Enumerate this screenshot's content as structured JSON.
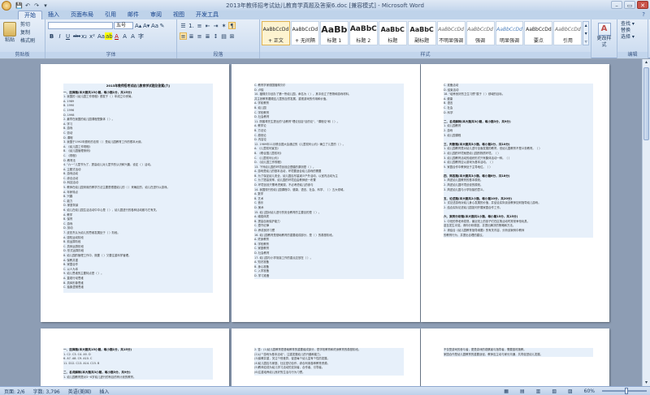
{
  "window": {
    "title": "2013年教师招考试幼儿教育学真题及答案6.doc [兼容模式] - Microsoft Word",
    "min": "–",
    "max": "▭",
    "close": "✕"
  },
  "qat": [
    "💾",
    "↶",
    "↷",
    "▾"
  ],
  "tabs": [
    "开始",
    "插入",
    "页面布局",
    "引用",
    "邮件",
    "审阅",
    "视图",
    "开发工具"
  ],
  "active_tab": "开始",
  "help_icon": "?",
  "clipboard": {
    "paste": "粘贴",
    "cut": "剪切",
    "copy": "复制",
    "format_painter": "格式刷",
    "label": "剪贴板"
  },
  "font": {
    "family": "",
    "size": "五号",
    "label": "字体",
    "buttons_row1": [
      "A▴",
      "A▾",
      "Aa",
      "✎",
      "变",
      "A"
    ],
    "buttons_row2": [
      "B",
      "I",
      "U",
      "abc",
      "x₂",
      "x²",
      "Aa",
      "ab",
      "A",
      "A",
      "A",
      "字"
    ]
  },
  "paragraph": {
    "label": "段落",
    "row1": [
      "☰",
      "1.",
      "≡",
      "⇤",
      "⇥",
      "✶",
      "¶"
    ],
    "row2": [
      "≡",
      "≣",
      "≡",
      "≣",
      "↕",
      "▤",
      "⊞"
    ]
  },
  "styles": {
    "label": "样式",
    "items": [
      {
        "sample": "AaBbCcDd",
        "name": "+ 正文",
        "cls": "",
        "selected": true
      },
      {
        "sample": "AaBbCcDd",
        "name": "+ 无间隔",
        "cls": ""
      },
      {
        "sample": "AaBb",
        "name": "标题 1",
        "cls": "h1"
      },
      {
        "sample": "AaBbC",
        "name": "标题 2",
        "cls": "h2"
      },
      {
        "sample": "AaBbC",
        "name": "标题",
        "cls": "h3"
      },
      {
        "sample": "AaBbC",
        "name": "副标题",
        "cls": "h3"
      },
      {
        "sample": "AaBbCcDd",
        "name": "不明显强调",
        "cls": "it"
      },
      {
        "sample": "AaBbCcDd",
        "name": "强调",
        "cls": "it"
      },
      {
        "sample": "AaBbCcDd",
        "name": "明显强调",
        "cls": "it blue"
      },
      {
        "sample": "AaBbCcDd",
        "name": "要点",
        "cls": ""
      },
      {
        "sample": "AaBbCcDd",
        "name": "引用",
        "cls": "it"
      }
    ],
    "scroll": [
      "▴",
      "▾",
      "▿"
    ]
  },
  "change_styles": {
    "label": "更改样式",
    "icon": "A"
  },
  "editing": {
    "find": "查找 ▾",
    "replace": "替换",
    "select": "选择 ▾",
    "label": "编辑"
  },
  "pages": [
    {
      "lines": [
        {
          "t": "title",
          "x": "2013年教师招考试幼儿教育学试题及答案(六)"
        },
        {
          "t": "gap",
          "x": ""
        },
        {
          "t": "h",
          "x": "一、选择题(本大题共15小题，每小题1分，共15分)"
        },
        {
          "x": "1. 我国的《幼儿园工作规程》颁发于（   ）年成立中央局。"
        },
        {
          "x": "A. 1989"
        },
        {
          "x": "B. 1990"
        },
        {
          "x": "C. 1996"
        },
        {
          "x": "D. 1998"
        },
        {
          "x": "2. 最早在我国的幼儿园课程是集体（   ）。"
        },
        {
          "x": "A. 学习"
        },
        {
          "x": "B. 游戏"
        },
        {
          "x": "C. 劳动"
        },
        {
          "x": "D. 课程"
        },
        {
          "x": "3. 我国于1992年颁布的法规（   ）是幼儿园教育工作的根本大纲。"
        },
        {
          "x": "A. 《幼儿园工作规程》"
        },
        {
          "x": "B. 《幼儿园管理条例》"
        },
        {
          "x": "C. 《规程》"
        },
        {
          "x": "D. 教育法"
        },
        {
          "x": "4. \"六一\"儿童节为了，提高幼儿对儿童节的认识和兴趣，设定（   ）活动。"
        },
        {
          "x": "A. 主题式活动"
        },
        {
          "x": "B. 游戏活动"
        },
        {
          "x": "C. 综合活动"
        },
        {
          "x": "D. 科技活动"
        },
        {
          "x": "5. 教师在幼儿园采用的教学方法主要是根据幼儿的（   ）来确定的，幼儿在进行以游戏。"
        },
        {
          "x": "A. 年龄特点"
        },
        {
          "x": "B. 兴趣"
        },
        {
          "x": "C. 能力"
        },
        {
          "x": "D. 家庭背景"
        },
        {
          "x": "6. 幼儿在幼儿园生活活动中中心是（   ），幼儿园进行的各种活动都与它有关。"
        },
        {
          "x": "A. 教学"
        },
        {
          "x": "B. 保育"
        },
        {
          "x": "C. 游戏"
        },
        {
          "x": "D. 劳动"
        },
        {
          "x": "7. 皮亚杰认为幼儿的思维发展处于（   ）阶段。"
        },
        {
          "x": "A. 感知运动阶段"
        },
        {
          "x": "B. 前运算阶段"
        },
        {
          "x": "C. 具体运算阶段"
        },
        {
          "x": "D. 形式运算阶段"
        },
        {
          "x": "8. 幼儿园的管理工作中，既要（   ）又要注重科学管理。"
        },
        {
          "x": "A. 保教并重"
        },
        {
          "x": "B. 家园合作"
        },
        {
          "x": "C. 以人为本"
        },
        {
          "x": "9. 幼儿思维的主要特点是（   ）。"
        },
        {
          "x": "A. 直观行动思维"
        },
        {
          "x": "B. 具体形象思维"
        },
        {
          "x": "C. 抽象逻辑思维"
        }
      ]
    },
    {
      "lines": [
        {
          "x": "C. 教育学家德国福禄贝尔"
        },
        {
          "x": "D. 卢梭"
        },
        {
          "x": "10. 福禄贝尔创办了第一所幼儿园，命名为（   ）。其中设立了恩物和游戏材料，"
        },
        {
          "x": "并主张教育要顺应儿童的自然发展，重视游戏的作用和价值。"
        },
        {
          "x": "A. 学前教育"
        },
        {
          "x": "B. 幼儿园"
        },
        {
          "x": "C. 学校教育"
        },
        {
          "x": "D. 社会教育"
        },
        {
          "x": "11. 陈鹤琴先生提出的\"活教育\"理论包括\"目的论\"、\"课程论\"和（   ）。"
        },
        {
          "x": "A. 教学论"
        },
        {
          "x": "B. 方法论"
        },
        {
          "x": "C. 原则论"
        },
        {
          "x": "D. 内容论"
        },
        {
          "x": "12. 1989年11月联合国大会通过的《儿童权利公约》确立了儿童的（   ）。"
        },
        {
          "x": "A. 《儿童权利宣言》"
        },
        {
          "x": "B. 《联合国儿童权利》"
        },
        {
          "x": "C. 《儿童权利公约》"
        },
        {
          "x": "D. 《幼儿园工作规程》"
        },
        {
          "x": "13. 下列幼儿园的环境创设应遵循的原则是（   ）。"
        },
        {
          "x": "A. 游戏是幼儿的基本活动，环境要适合幼儿游戏的需要"
        },
        {
          "x": "B. 为了保证幼儿安全，幼儿园应尽量减少户外活动，以室内活动为主"
        },
        {
          "x": "C. 为了提高效率，幼儿园的环境应由教师统一布置"
        },
        {
          "x": "D. 环境创设只需考虑美观，不必考虑幼儿的参与"
        },
        {
          "x": "14. 我国现行的幼儿园课程中，健康、语言、社会、科学、（   ）五大领域。"
        },
        {
          "x": "A. 数学"
        },
        {
          "x": "B. 艺术"
        },
        {
          "x": "C. 音乐"
        },
        {
          "x": "D. 美术"
        },
        {
          "x": "15. 幼儿园对幼儿进行的安全教育的主要目的是（   ）。"
        },
        {
          "x": "A. 增强体质"
        },
        {
          "x": "B. 提高自我保护能力"
        },
        {
          "x": "C. 遵守纪律"
        },
        {
          "x": "D. 养成良好习惯"
        },
        {
          "x": "16. 幼儿园教育是基础教育的重要组成部分，是（   ）的奠基阶段。"
        },
        {
          "x": "A. 终身教育"
        },
        {
          "x": "B. 学校教育"
        },
        {
          "x": "C. 家庭教育"
        },
        {
          "x": "D. 社会教育"
        },
        {
          "x": "17. 幼儿园与小学衔接工作的重点应放在（   ）。"
        },
        {
          "x": "A. 知识准备"
        },
        {
          "x": "B. 身心准备"
        },
        {
          "x": "C. 入学准备"
        },
        {
          "x": "D. 学习准备"
        }
      ]
    },
    {
      "lines": [
        {
          "x": "C. 准备活动"
        },
        {
          "x": "D. 结束活动"
        },
        {
          "x": "18. \"培养良好的卫生习惯\"属于（   ）领域的目标。"
        },
        {
          "x": "A. 健康"
        },
        {
          "x": "B. 语言"
        },
        {
          "x": "C. 社会"
        },
        {
          "x": "D. 科学"
        },
        {
          "x": ""
        },
        {
          "t": "h",
          "x": "二、名词解释(本大题共3小题，每小题3分，共9分)"
        },
        {
          "x": "1. 幼儿园教育"
        },
        {
          "x": "2. 游戏"
        },
        {
          "x": "3. 幼儿园课程"
        },
        {
          "x": ""
        },
        {
          "t": "h",
          "x": "三、判断题(本大题共5小题，每小题2分，共10分)"
        },
        {
          "x": "1. 幼儿园教育是对幼儿进行全面发展的教育，但幼儿园教育不是义务教育。（   ）"
        },
        {
          "x": "2. 幼儿园的环境就是幼儿园的物质环境。（   ）"
        },
        {
          "x": "3. 幼儿园教育活动的组织形式只有集体活动一种。（   ）"
        },
        {
          "x": "4. 幼儿园教育应以游戏为基本活动。（   ）"
        },
        {
          "x": "5. 家园合作中教师处于主导地位。（   ）"
        },
        {
          "x": ""
        },
        {
          "t": "h",
          "x": "四、简答题(本大题共3小题，每小题6分，共18分)"
        },
        {
          "x": "1. 简述幼儿园教育的基本原则。"
        },
        {
          "x": "2. 简述幼儿园环境创设的原则。"
        },
        {
          "x": "3. 简述幼儿园与小学衔接的意义。"
        },
        {
          "x": ""
        },
        {
          "t": "h",
          "x": "五、论述题(本大题共2小题，每小题10分，共20分)"
        },
        {
          "x": "1. 试论述游戏对幼儿身心发展的价值，并结合实际谈谈教师如何指导幼儿游戏。"
        },
        {
          "x": "2. 结合实际论述幼儿园如何开展家园合作工作。"
        },
        {
          "x": ""
        },
        {
          "t": "h",
          "x": "六、案例分析题(本大题共1小题，每小题15分，共15分)"
        },
        {
          "x": "1. 中班的李老师发现，最近班上的孩子们在区角活动时常常争抢玩具，"
        },
        {
          "x": "甚至发生冲突。请你分析原因，并提出解决的策略和方法。"
        },
        {
          "x": "2. 请结合《幼儿园教育指导纲要》的有关内容，分析该案例中教师"
        },
        {
          "x": "的教育行为，并提出合理的建议。"
        }
      ]
    },
    {
      "lines": [
        {
          "t": "h",
          "x": "一、选择题(本大题共15小题，每小题1分，共15分)"
        },
        {
          "x": "1. C2. C3. C4. A5. D"
        },
        {
          "x": "6. A7. A8. C9. A10. C"
        },
        {
          "x": "11. D12. C13. A14. C15. B"
        },
        {
          "x": ""
        },
        {
          "t": "h",
          "x": "二、名词解释(本大题共3小题，每小题3分，共9分)"
        },
        {
          "x": "1. 幼儿园教育是对3~6岁幼儿进行的有目的有计划的教育。"
        }
      ]
    },
    {
      "lines": [
        {
          "x": "2. 答：(1)幼儿园教育是基础教育的重要组成部分，是学校教育和终身教育的奠基阶段。"
        },
        {
          "x": "(2)以\"\"游戏为基本活动\"，注重发展幼儿的兴趣和能力。"
        },
        {
          "x": "(3)保教并重，关注个别差异，促进每个幼儿富有个性的发展。"
        },
        {
          "x": "(4)幼儿园应与家庭、社区密切合作，综合利用各种教育资源。"
        },
        {
          "x": "(5)教师应成为幼儿学习活动的支持者、合作者、引导者。"
        },
        {
          "x": "(6)注重培养幼儿良好的生活与行为习惯。"
        }
      ]
    },
    {
      "lines": [
        {
          "x": "不仅是游戏的参与者，更是游戏的观察者与指导者，需要因材施教。"
        },
        {
          "x": "家园合作是幼儿园教育的重要途径，教师应主动与家长沟通，共同促进幼儿发展。"
        }
      ]
    }
  ],
  "status": {
    "page": "页面: 2/6",
    "words": "字数: 3,796",
    "lang": "英语(美国)",
    "mode": "插入",
    "zoom": "60%",
    "zoom_level": 0.6,
    "view_icons": [
      "▦",
      "▤",
      "▥",
      "▧",
      "▨"
    ]
  }
}
